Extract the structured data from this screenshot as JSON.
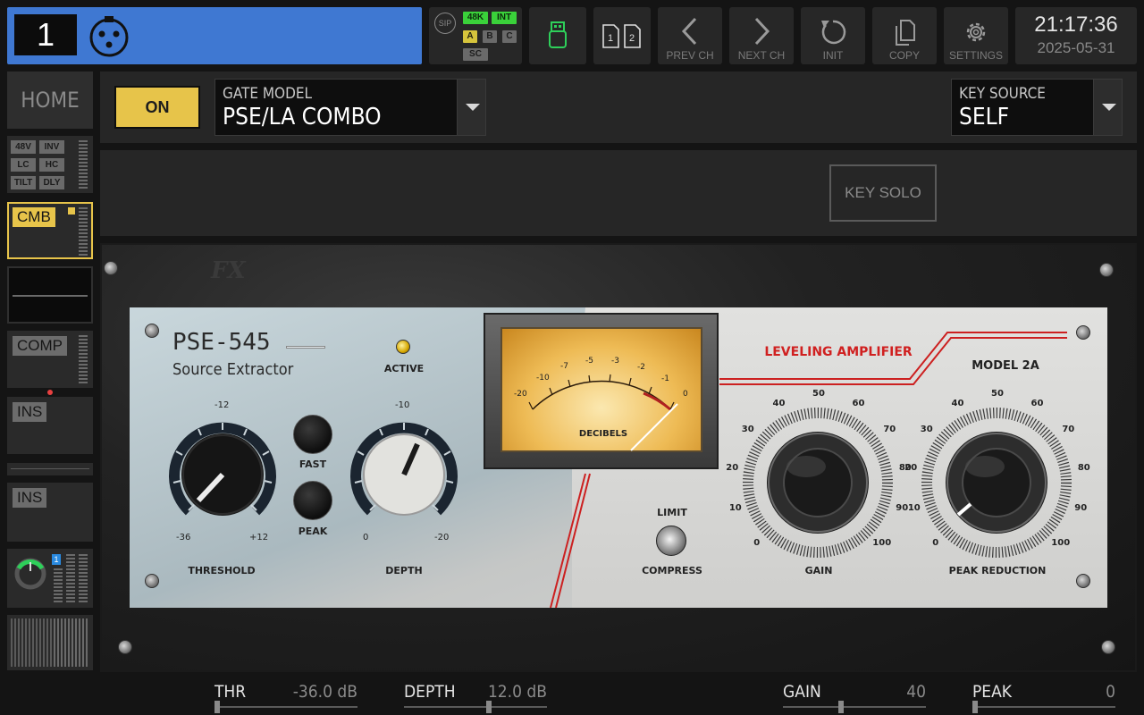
{
  "topbar": {
    "channel_number": "1",
    "status": {
      "sip": "SIP",
      "rate": "48K",
      "clock": "INT",
      "a": "A",
      "b": "B",
      "c": "C",
      "sc": "SC"
    },
    "prev_label": "PREV CH",
    "next_label": "NEXT CH",
    "init_label": "INIT",
    "copy_label": "COPY",
    "settings_label": "SETTINGS",
    "time": "21:17:36",
    "date": "2025-05-31"
  },
  "sidebar": {
    "home": "HOME",
    "input_tags": [
      "48V",
      "INV",
      "LC",
      "HC",
      "TILT",
      "DLY"
    ],
    "cmb": "CMB",
    "comp": "COMP",
    "ins1": "INS",
    "ins2": "INS",
    "send_badge": "1"
  },
  "header": {
    "on": "ON",
    "gate_model_caption": "GATE MODEL",
    "gate_model_value": "PSE/LA COMBO",
    "key_source_caption": "KEY SOURCE",
    "key_source_value": "SELF",
    "key_solo": "KEY SOLO"
  },
  "plugin": {
    "brand": "FX",
    "pse_title": "PSE-545",
    "pse_subtitle": "Source Extractor",
    "active": "ACTIVE",
    "threshold": "THRESHOLD",
    "threshold_scale": [
      "-12",
      "-36",
      "+12"
    ],
    "fast": "FAST",
    "peak": "PEAK",
    "depth": "DEPTH",
    "depth_scale": [
      "-10",
      "0",
      "-20"
    ],
    "vu_scale": [
      "-20",
      "-10",
      "-7",
      "-5",
      "-3",
      "-2",
      "-1",
      "0"
    ],
    "vu_label": "DECIBELS",
    "la_title": "LEVELING AMPLIFIER",
    "la_model": "MODEL 2A",
    "limit": "LIMIT",
    "compress": "COMPRESS",
    "gain": "GAIN",
    "peak_reduction": "PEAK REDUCTION",
    "knob_scale": [
      "0",
      "10",
      "20",
      "30",
      "40",
      "50",
      "60",
      "70",
      "80",
      "90",
      "100"
    ]
  },
  "params": [
    {
      "name": "THR",
      "value": "-36.0 dB",
      "level": 0.0
    },
    {
      "name": "DEPTH",
      "value": "12.0 dB",
      "level": 0.6
    },
    {
      "name": "GAIN",
      "value": "40",
      "level": 0.4
    },
    {
      "name": "PEAK",
      "value": "0",
      "level": 0.0
    }
  ]
}
